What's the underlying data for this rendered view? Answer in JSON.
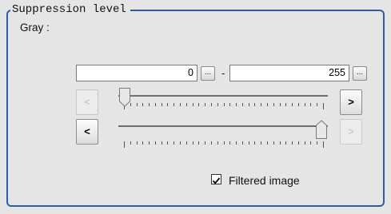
{
  "group": {
    "title": "Suppression level"
  },
  "gray": {
    "label": "Gray :",
    "min_value": "0",
    "max_value": "255",
    "min_dots": "...",
    "max_dots": "...",
    "separator": "-",
    "lower_slider_fraction": 0.0,
    "upper_slider_fraction": 1.0
  },
  "buttons": {
    "lower_decrement": "<",
    "lower_increment": ">",
    "upper_decrement": "<",
    "upper_increment": ">"
  },
  "options": {
    "filtered_image_label": "Filtered image",
    "filtered_image_checked": true
  },
  "colors": {
    "group_border": "#2f5da0",
    "background": "#e5e5e5"
  }
}
